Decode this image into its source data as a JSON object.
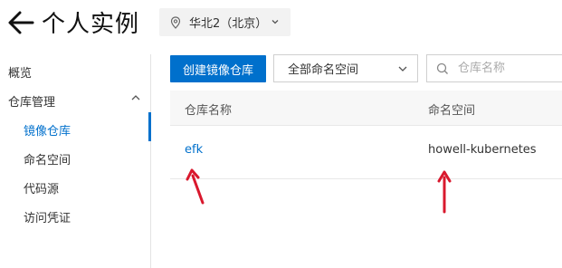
{
  "header": {
    "title": "个人实例",
    "region": "华北2（北京）"
  },
  "sidebar": {
    "overview": "概览",
    "repo_mgmt": "仓库管理",
    "items": [
      {
        "label": "镜像仓库",
        "active": true
      },
      {
        "label": "命名空间",
        "active": false
      },
      {
        "label": "代码源",
        "active": false
      },
      {
        "label": "访问凭证",
        "active": false
      }
    ]
  },
  "toolbar": {
    "create_label": "创建镜像仓库",
    "namespace_filter": "全部命名空间",
    "search_placeholder": "仓库名称"
  },
  "table": {
    "columns": [
      "仓库名称",
      "命名空间"
    ],
    "rows": [
      {
        "name": "efk",
        "namespace": "howell-kubernetes"
      }
    ]
  },
  "colors": {
    "accent": "#0070cc",
    "annotation": "#d9182d"
  },
  "icons": [
    "back-arrow-icon",
    "location-pin-icon",
    "chevron-down-icon",
    "chevron-up-icon",
    "search-icon"
  ]
}
